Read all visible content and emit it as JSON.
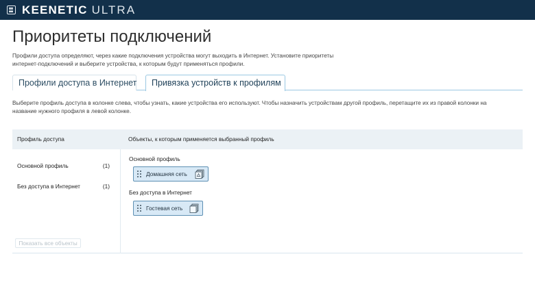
{
  "header": {
    "brand_primary": "KEENETIC",
    "brand_secondary": "ULTRA",
    "bar_color": "#12304a"
  },
  "page": {
    "title": "Приоритеты подключений",
    "intro_line1": "Профили доступа определяют, через какие подключения устройства могут выходить в Интернет. Установите приоритеты",
    "intro_line2": "интернет-подключений и выберите устройства, к которым будут применяться профили."
  },
  "tabs": [
    {
      "label": "Профили доступа в Интернет",
      "active": false
    },
    {
      "label": "Привязка устройств к профилям",
      "active": true
    }
  ],
  "tab_description": {
    "line1": "Выберите профиль доступа в колонке слева, чтобы узнать, какие устройства его используют. Чтобы назначить устройствам другой профиль, перетащите их из правой колонки на",
    "line2": "название нужного профиля в левой колонке."
  },
  "columns": {
    "left_header": "Профиль доступа",
    "right_header": "Объекты, к которым применяется выбранный профиль"
  },
  "profiles": [
    {
      "name": "Основной профиль",
      "count": "(1)"
    },
    {
      "name": "Без доступа в Интернет",
      "count": "(1)"
    }
  ],
  "show_all_button": "Показать все объекты",
  "groups": [
    {
      "label": "Основной профиль",
      "devices": [
        {
          "name": "Домашняя сеть",
          "icon": "network-segment-icon"
        }
      ]
    },
    {
      "label": "Без доступа в Интернет",
      "devices": [
        {
          "name": "Гостевая сеть",
          "icon": "network-segment-icon"
        }
      ]
    }
  ],
  "colors": {
    "accent": "#9bc8e2",
    "device_fill": "#d8e9f6",
    "device_border": "#5d8fb3",
    "header_row": "#ebf1f5"
  }
}
